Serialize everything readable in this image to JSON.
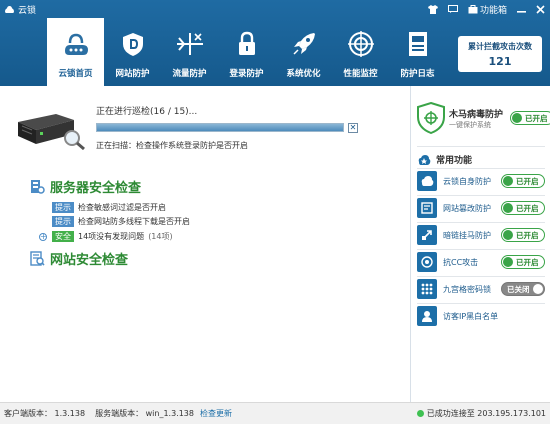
{
  "app": {
    "title": "云锁"
  },
  "window": {
    "function_box_label": "功能箱"
  },
  "nav": {
    "items": [
      {
        "label": "云锁首页",
        "icon": "cloud-lock-icon",
        "active": true
      },
      {
        "label": "网站防护",
        "icon": "web-shield-icon"
      },
      {
        "label": "流量防护",
        "icon": "traffic-icon"
      },
      {
        "label": "登录防护",
        "icon": "login-lock-icon"
      },
      {
        "label": "系统优化",
        "icon": "rocket-icon"
      },
      {
        "label": "性能监控",
        "icon": "monitor-target-icon"
      },
      {
        "label": "防护日志",
        "icon": "log-icon"
      }
    ]
  },
  "counter": {
    "label": "累计拦截攻击次数",
    "value": "121"
  },
  "scan": {
    "title": "正在进行巡检(16 / 15)...",
    "progress": 1.0,
    "status": "正在扫描：检查操作系统登录防护是否开启"
  },
  "sections": {
    "server": {
      "title": "服务器安全检查",
      "items": [
        {
          "tag": "提示",
          "text": "检查敏感词过滤是否开启"
        },
        {
          "tag": "提示",
          "text": "检查网站防多线程下载是否开启"
        }
      ],
      "summary": {
        "tag": "安全",
        "text": "14项没有发现问题",
        "count": "(14项)"
      }
    },
    "web": {
      "title": "网站安全检查"
    }
  },
  "sidebar": {
    "trojan": {
      "title": "木马病毒防护",
      "subtitle": "一键保护系统",
      "toggle": "已开启"
    },
    "common_title": "常用功能",
    "features": [
      {
        "label": "云锁自身防护",
        "icon": "cloud-self-icon",
        "state": "已开启",
        "on": true
      },
      {
        "label": "网站篡改防护",
        "icon": "page-tamper-icon",
        "state": "已开启",
        "on": true
      },
      {
        "label": "暗链挂马防护",
        "icon": "dark-link-icon",
        "state": "已开启",
        "on": true
      },
      {
        "label": "抗CC攻击",
        "icon": "cc-attack-icon",
        "state": "已开启",
        "on": true
      },
      {
        "label": "九宫格密码锁",
        "icon": "grid-lock-icon",
        "state": "已关闭",
        "on": false
      },
      {
        "label": "访客IP黑白名单",
        "icon": "ip-list-icon",
        "state": "",
        "on": null
      }
    ]
  },
  "status": {
    "client": "客户端版本： 1.3.138",
    "server": "服务端版本： win_1.3.138",
    "update": "检查更新",
    "connection": "已成功连接至 203.195.173.101"
  },
  "colors": {
    "header": "#1a63a0",
    "accent_green": "#3aa448",
    "tip_blue": "#4c8cc6"
  }
}
